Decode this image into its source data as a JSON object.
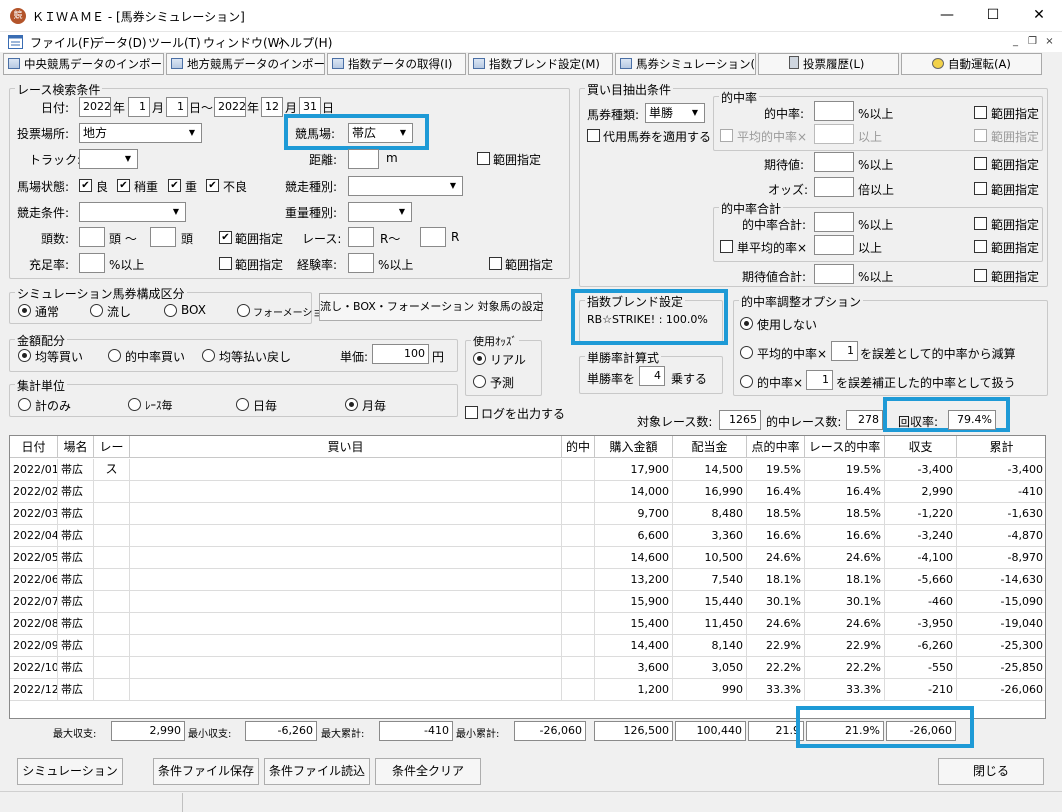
{
  "window": {
    "icon_text": "競",
    "title": "ＫＩＷＡＭＥ - [馬券シミュレーション]",
    "min": "—",
    "max": "☐",
    "close": "✕"
  },
  "menu": [
    "ファイル(F)",
    "データ(D)",
    "ツール(T)",
    "ウィンドウ(W)",
    "ヘルプ(H)"
  ],
  "mdi": {
    "min": "_",
    "restore": "❐",
    "close": "×"
  },
  "toolbar": [
    "中央競馬データのインポート(J)",
    "地方競馬データのインポート(N)",
    "指数データの取得(I)",
    "指数ブレンド設定(M)",
    "馬券シミュレーション(B)",
    "投票履歴(L)",
    "自動運転(A)"
  ],
  "search": {
    "title": "レース検索条件",
    "date_label": "日付:",
    "y1": "2022",
    "year": "年",
    "m1": "1",
    "month": "月",
    "d1": "1",
    "day_tilde": "日〜",
    "y2": "2022",
    "m2": "12",
    "d2": "31",
    "day": "日",
    "place_label": "投票場所:",
    "place": "地方",
    "course_label": "競馬場:",
    "course": "帯広",
    "track_label": "トラック:",
    "distance_label": "距離:",
    "distance_unit": "m",
    "range": "範囲指定",
    "baba_label": "馬場状態:",
    "baba": [
      "良",
      "稍重",
      "重",
      "不良"
    ],
    "race_type_label": "競走種別:",
    "cond_label": "競走条件:",
    "weight_label": "重量種別:",
    "heads_label": "頭数:",
    "heads_unit": "頭",
    "heads_tilde": "頭 〜",
    "race_label": "レース:",
    "race_unit": "R",
    "race_tilde": "R〜",
    "fill_label": "充足率:",
    "pct_up": "%以上",
    "exp_label": "経験率:"
  },
  "buy": {
    "title": "買い目抽出条件",
    "type_label": "馬券種類:",
    "type": "単勝",
    "daiyo": "代用馬券を適用する",
    "hit_group": "的中率",
    "hit_label": "的中率:",
    "avg_hit": "平均的中率×",
    "up": "以上",
    "ev_label": "期待値:",
    "odds_label": "オッズ:",
    "odds_unit": "倍以上",
    "sum_group": "的中率合計",
    "sum_label": "的中率合計:",
    "single_avg": "単平均的率×",
    "ev_sum": "期待値合計:"
  },
  "sim": {
    "title": "シミュレーション馬券構成区分",
    "options": [
      "通常",
      "流し",
      "BOX",
      "フォーメーション"
    ],
    "button": "流し・BOX・フォーメーション 対象馬の設定"
  },
  "blend": {
    "title": "指数ブレンド設定",
    "value": "RB☆STRIKE! : 100.0%"
  },
  "adjust": {
    "title": "的中率調整オプション",
    "opt1": "使用しない",
    "opt2a": "平均的中率×",
    "opt2b": "を誤差として的中率から減算",
    "opt3a": "的中率×",
    "opt3b": "を誤差補正した的中率として扱う",
    "v2": "1",
    "v3": "1"
  },
  "money": {
    "title": "金額配分",
    "options": [
      "均等買い",
      "的中率買い",
      "均等払い戻し"
    ],
    "unit_label": "単価:",
    "unit_value": "100",
    "yen": "円"
  },
  "odds": {
    "title": "使用ｵｯｽﾞ",
    "options": [
      "リアル",
      "予測"
    ]
  },
  "win_formula": {
    "title": "単勝率計算式",
    "pre": "単勝率を",
    "value": "4",
    "post": "乗する"
  },
  "agg": {
    "title": "集計単位",
    "options": [
      "計のみ",
      "ﾚｰｽ毎",
      "日毎",
      "月毎"
    ],
    "log": "ログを出力する"
  },
  "summary": {
    "races_label": "対象レース数:",
    "races": "1265",
    "hits_label": "的中レース数:",
    "hits": "278",
    "recovery_label": "回収率:",
    "recovery": "79.4%"
  },
  "table": {
    "headers": [
      "日付",
      "場名",
      "レース",
      "買い目",
      "的中",
      "購入金額",
      "配当金",
      "点的中率",
      "レース的中率",
      "収支",
      "累計"
    ],
    "rows": [
      [
        "2022/01",
        "帯広",
        "",
        "",
        "",
        "17,900",
        "14,500",
        "19.5%",
        "19.5%",
        "-3,400",
        "-3,400"
      ],
      [
        "2022/02",
        "帯広",
        "",
        "",
        "",
        "14,000",
        "16,990",
        "16.4%",
        "16.4%",
        "2,990",
        "-410"
      ],
      [
        "2022/03",
        "帯広",
        "",
        "",
        "",
        "9,700",
        "8,480",
        "18.5%",
        "18.5%",
        "-1,220",
        "-1,630"
      ],
      [
        "2022/04",
        "帯広",
        "",
        "",
        "",
        "6,600",
        "3,360",
        "16.6%",
        "16.6%",
        "-3,240",
        "-4,870"
      ],
      [
        "2022/05",
        "帯広",
        "",
        "",
        "",
        "14,600",
        "10,500",
        "24.6%",
        "24.6%",
        "-4,100",
        "-8,970"
      ],
      [
        "2022/06",
        "帯広",
        "",
        "",
        "",
        "13,200",
        "7,540",
        "18.1%",
        "18.1%",
        "-5,660",
        "-14,630"
      ],
      [
        "2022/07",
        "帯広",
        "",
        "",
        "",
        "15,900",
        "15,440",
        "30.1%",
        "30.1%",
        "-460",
        "-15,090"
      ],
      [
        "2022/08",
        "帯広",
        "",
        "",
        "",
        "15,400",
        "11,450",
        "24.6%",
        "24.6%",
        "-3,950",
        "-19,040"
      ],
      [
        "2022/09",
        "帯広",
        "",
        "",
        "",
        "14,400",
        "8,140",
        "22.9%",
        "22.9%",
        "-6,260",
        "-25,300"
      ],
      [
        "2022/10",
        "帯広",
        "",
        "",
        "",
        "3,600",
        "3,050",
        "22.2%",
        "22.2%",
        "-550",
        "-25,850"
      ],
      [
        "2022/12",
        "帯広",
        "",
        "",
        "",
        "1,200",
        "990",
        "33.3%",
        "33.3%",
        "-210",
        "-26,060"
      ]
    ]
  },
  "footer": {
    "max_income_label": "最大収支:",
    "max_income": "2,990",
    "min_income_label": "最小収支:",
    "min_income": "-6,260",
    "max_cum_label": "最大累計:",
    "max_cum": "-410",
    "min_cum_label": "最小累計:",
    "min_cum": "-26,060",
    "total_buy": "126,500",
    "total_pay": "100,440",
    "total_hit": "21.9",
    "total_race_hit": "21.9%",
    "total_cum": "-26,060"
  },
  "buttons": {
    "simulate": "シミュレーション",
    "save": "条件ファイル保存",
    "load": "条件ファイル読込",
    "clear": "条件全クリア",
    "close": "閉じる"
  },
  "colors": {
    "highlight": "#1e9ad6"
  }
}
